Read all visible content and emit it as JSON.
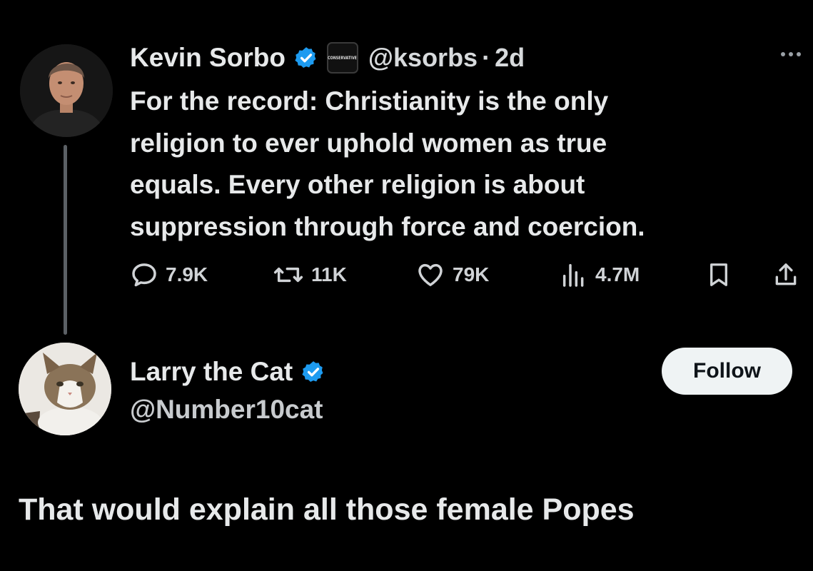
{
  "tweet": {
    "author_name": "Kevin Sorbo",
    "affiliate_badge_text": "CONSERVATIVE",
    "handle": "@ksorbs",
    "separator": "·",
    "time": "2d",
    "text_lines": [
      "For the record: Christianity is the only",
      "religion to ever uphold women as true",
      "equals. Every other religion is about",
      "suppression through force and coercion."
    ],
    "stats": {
      "replies": "7.9K",
      "reposts": "11K",
      "likes": "79K",
      "views": "4.7M"
    }
  },
  "reply": {
    "author_name": "Larry the Cat",
    "handle": "@Number10cat",
    "follow_label": "Follow",
    "text": "That would explain all those female Popes"
  },
  "colors": {
    "background": "#000000",
    "verified": "#1d9bf0",
    "text": "#e7e9ea",
    "muted": "#9aa0a6"
  }
}
